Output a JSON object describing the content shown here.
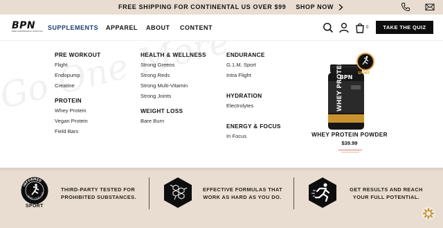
{
  "promo": {
    "text": "FREE SHIPPING FOR CONTINENTAL US OVER $99",
    "link_label": "SHOP NOW",
    "chevron_icon": "chevron-right-icon",
    "phone_icon": "phone-icon",
    "mail_icon": "mail-icon"
  },
  "header": {
    "logo_text": "BPN",
    "logo_tagline": "BARE PERFORMANCE NUTRITION",
    "nav": [
      "SUPPLEMENTS",
      "APPAREL",
      "ABOUT",
      "CONTENT"
    ],
    "active_nav": "SUPPLEMENTS",
    "cart_count": "0",
    "quiz_label": "TAKE THE QUIZ",
    "icons": [
      "search-icon",
      "user-icon",
      "cart-icon"
    ]
  },
  "mega_menu": {
    "watermark": "Go One More",
    "col1": {
      "group1": {
        "title": "PRE WORKOUT",
        "items": [
          "Flight",
          "Endopump",
          "Creatine"
        ]
      },
      "group2": {
        "title": "PROTEIN",
        "items": [
          "Whey Protein",
          "Vegan Protein",
          "Field Bars"
        ]
      }
    },
    "col2": {
      "group1": {
        "title": "HEALTH & WELLNESS",
        "items": [
          "Strong Greens",
          "Strong Reds",
          "Strong Multi-Vitamin",
          "Strong Joints"
        ]
      },
      "group2": {
        "title": "WEIGHT LOSS",
        "items": [
          "Bare Burn"
        ]
      }
    },
    "col3": {
      "group1": {
        "title": "ENDURANCE",
        "items": [
          "G.1.M. Sport",
          "Intra Flight"
        ]
      },
      "group2": {
        "title": "HYDRATION",
        "items": [
          "Electrolytes"
        ]
      },
      "group3": {
        "title": "ENERGY & FOCUS",
        "items": [
          "In Focus"
        ]
      }
    },
    "featured": {
      "name": "WHEY PROTEIN POWDER",
      "price": "$39.99",
      "jar_brand": "BPN",
      "jar_label": "WHEY PROTEIN",
      "badge_label": "SPORT"
    }
  },
  "benefits": [
    {
      "icon": "informed-sport-badge-icon",
      "label": "SPORT",
      "badge_ring": "INFORMED",
      "badge_sub": "TRUST • TEST • SPORT",
      "text_line1": "THIRD-PARTY TESTED FOR",
      "text_line2": "PROHIBITED SUBSTANCES."
    },
    {
      "icon": "molecule-hexagon-icon",
      "text_line1": "EFFECTIVE FORMULAS THAT",
      "text_line2": "WORK AS HARD AS YOU DO."
    },
    {
      "icon": "runner-hexagon-icon",
      "text_line1": "GET RESULTS AND REACH",
      "text_line2": "YOUR FULL POTENTIAL."
    }
  ],
  "colors": {
    "band": "#e8ddd0",
    "accent_nav": "#1e3d6e",
    "badge_gold": "#e6a23c",
    "button": "#0d0d0d"
  },
  "settings_icon": "gear-icon"
}
